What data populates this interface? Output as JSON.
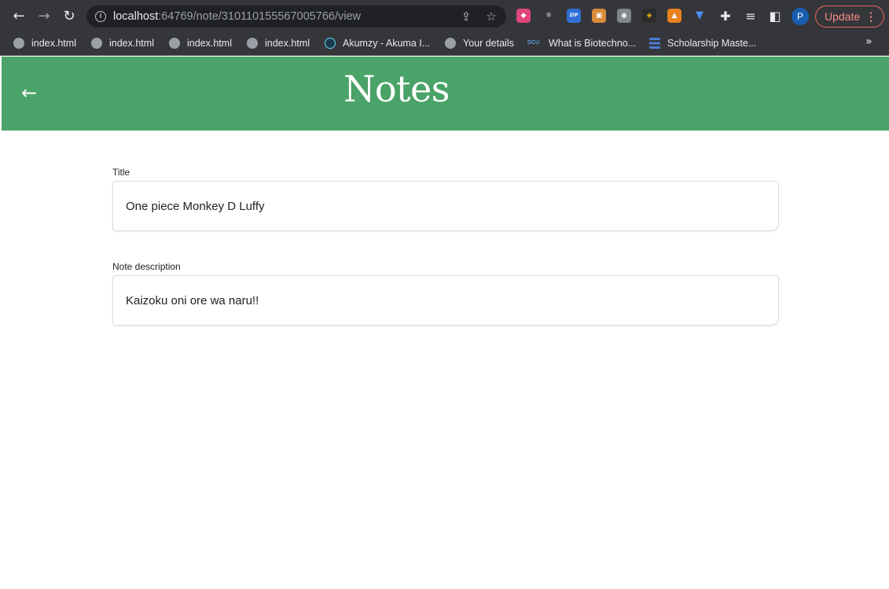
{
  "browser": {
    "url_host": "localhost",
    "url_rest": ":64769/note/310110155567005766/view",
    "profile_initial": "P",
    "update_label": "Update",
    "extensions": [
      {
        "name": "colorful-extension-icon",
        "glyph": "◆",
        "color": "#e0457b"
      },
      {
        "name": "react-devtools-icon",
        "glyph": "⚛",
        "color": "#35363a"
      },
      {
        "name": "zip-extension-icon",
        "glyph": "ZIP",
        "color": "#2f6fd6"
      },
      {
        "name": "image-extension-icon",
        "glyph": "▣",
        "color": "#d98b3a"
      },
      {
        "name": "camera-extension-icon",
        "glyph": "◉",
        "color": "#80868b"
      },
      {
        "name": "cube-extension-icon",
        "glyph": "◈",
        "color": "#2b2b2b"
      },
      {
        "name": "metamask-extension-icon",
        "glyph": "▲",
        "color": "#e8821e"
      },
      {
        "name": "shield-extension-icon",
        "glyph": "▼",
        "color": "#35363a"
      }
    ]
  },
  "bookmarks": [
    {
      "label": "index.html",
      "favicon": "globe"
    },
    {
      "label": "index.html",
      "favicon": "globe"
    },
    {
      "label": "index.html",
      "favicon": "globe"
    },
    {
      "label": "index.html",
      "favicon": "globe"
    },
    {
      "label": "Akumzy - Akuma I...",
      "favicon": "react"
    },
    {
      "label": "Your details",
      "favicon": "globe"
    },
    {
      "label": "What is Biotechno...",
      "favicon": "dcu",
      "favicon_text": "DCU"
    },
    {
      "label": "Scholarship Maste...",
      "favicon": "doc"
    }
  ],
  "header": {
    "title": "Notes",
    "background": "#4aa368"
  },
  "form": {
    "title_label": "Title",
    "title_value": "One piece Monkey D Luffy",
    "description_label": "Note description",
    "description_value": "Kaizoku oni ore wa naru!!"
  }
}
